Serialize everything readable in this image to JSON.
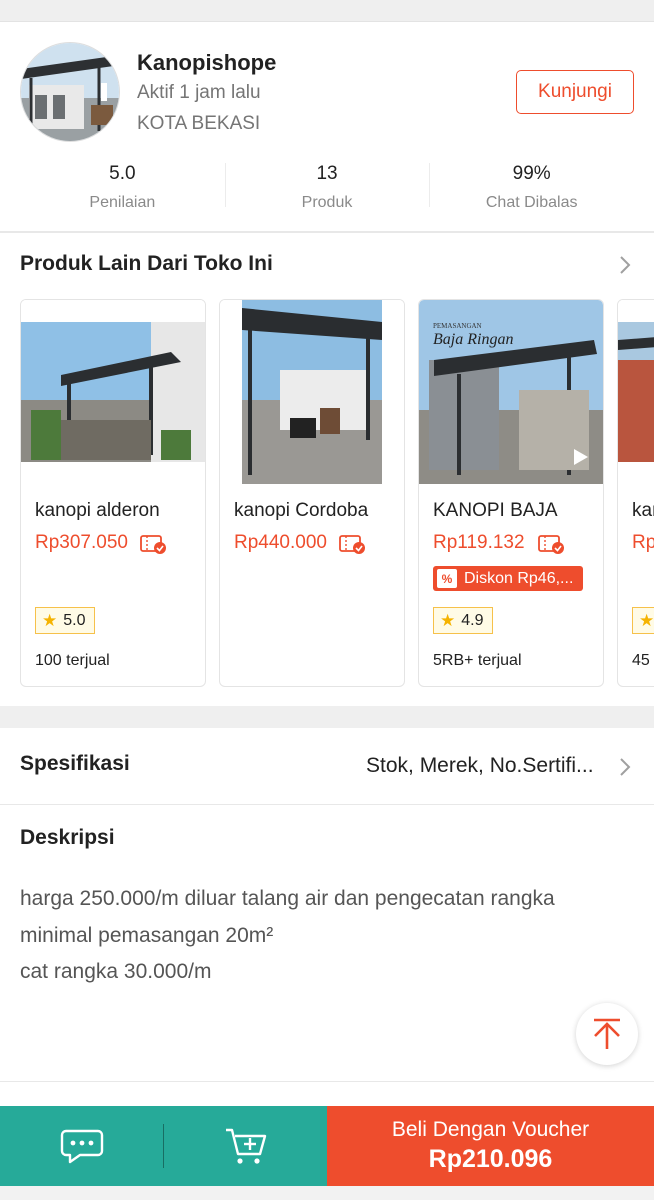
{
  "shop": {
    "name": "Kanopishope",
    "active": "Aktif 1 jam lalu",
    "city": "KOTA BEKASI",
    "visit_label": "Kunjungi",
    "stats": [
      {
        "value": "5.0",
        "label": "Penilaian"
      },
      {
        "value": "13",
        "label": "Produk"
      },
      {
        "value": "99%",
        "label": "Chat Dibalas"
      }
    ]
  },
  "other_products": {
    "title": "Produk Lain Dari Toko Ini",
    "items": [
      {
        "name": "kanopi alderon",
        "price": "Rp307.050",
        "rating": "5.0",
        "sold": "100 terjual"
      },
      {
        "name": "kanopi Cordoba",
        "price": "Rp440.000"
      },
      {
        "name": "KANOPI BAJA",
        "price": "Rp119.132",
        "discount": "Diskon Rp46,...",
        "rating": "4.9",
        "sold": "5RB+ terjual",
        "image_caption_small": "PEMASANGAN",
        "image_caption": "Baja Ringan"
      },
      {
        "name": "kan",
        "price": "Rp",
        "sold": "45"
      }
    ]
  },
  "specifications": {
    "title": "Spesifikasi",
    "value": "Stok, Merek, No.Sertifi..."
  },
  "description": {
    "title": "Deskripsi",
    "lines": [
      "harga 250.000/m diluar talang air dan pengecatan rangka",
      "minimal pemasangan 20m²",
      "cat rangka 30.000/m"
    ]
  },
  "bottom_bar": {
    "buy_label": "Beli Dengan Voucher",
    "buy_price": "Rp210.096"
  },
  "colors": {
    "accent": "#ee4d2d",
    "teal": "#26aa99",
    "muted_text": "#757575"
  },
  "icons": [
    "chevron-right-icon",
    "voucher-check-icon",
    "star-icon",
    "play-icon",
    "chat-icon",
    "add-to-cart-icon",
    "scroll-to-top-icon"
  ]
}
